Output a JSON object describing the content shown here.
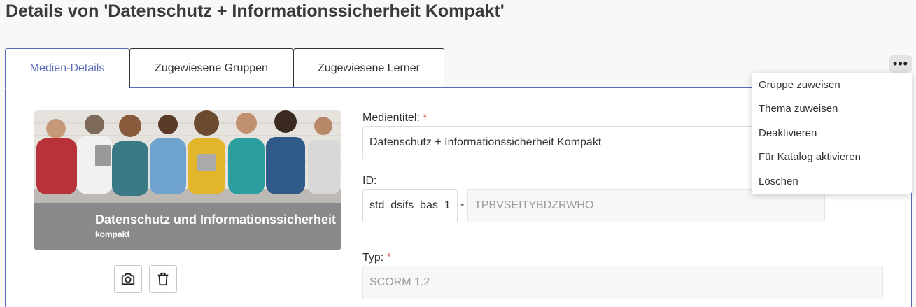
{
  "page": {
    "title": "Details von 'Datenschutz + Informationssicherheit Kompakt'"
  },
  "tabs": [
    {
      "label": "Medien-Details",
      "active": true
    },
    {
      "label": "Zugewiesene Gruppen",
      "active": false
    },
    {
      "label": "Zugewiesene Lerner",
      "active": false
    }
  ],
  "more_menu": {
    "button_icon": "more-horizontal-icon",
    "items": [
      {
        "label": "Gruppe zuweisen"
      },
      {
        "label": "Thema zuweisen"
      },
      {
        "label": "Deaktivieren"
      },
      {
        "label": "Für Katalog aktivieren"
      },
      {
        "label": "Löschen"
      }
    ]
  },
  "media_image": {
    "title": "Datenschutz und Informationssicherheit",
    "subtitle": "kompakt"
  },
  "image_actions": {
    "camera_icon": "camera-icon",
    "delete_icon": "trash-icon"
  },
  "form": {
    "title_label": "Medientitel:",
    "title_required": "*",
    "title_value": "Datenschutz + Informationssicherheit Kompakt",
    "id_label": "ID:",
    "id_prefix": "std_dsifs_bas_1",
    "id_separator": "-",
    "id_suffix": "TPBVSEITYBDZRWHO",
    "type_label": "Typ:",
    "type_required": "*",
    "type_value": "SCORM 1.2"
  },
  "colors": {
    "accent": "#5a68b7",
    "required": "#d9534f",
    "image_overlay": "#8a8a8a"
  }
}
